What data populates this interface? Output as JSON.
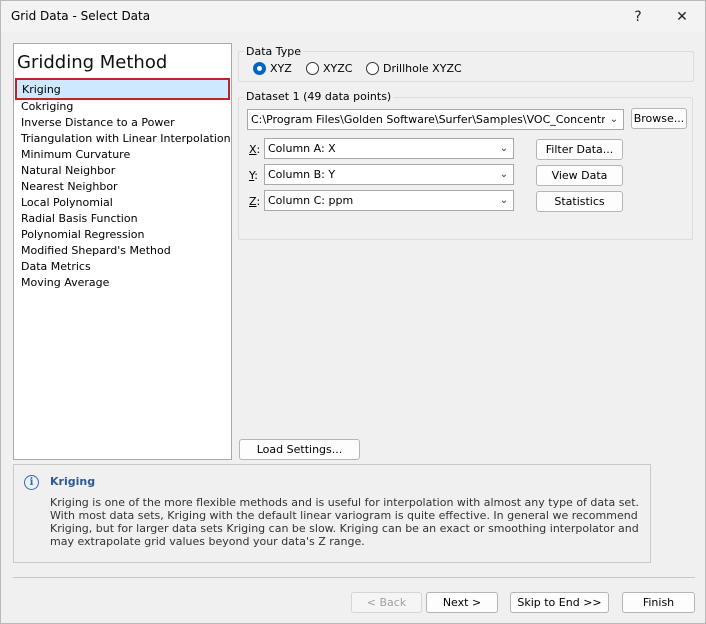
{
  "window": {
    "title": "Grid Data - Select Data",
    "help_label": "?",
    "close_label": "✕"
  },
  "methods": {
    "heading": "Gridding Method",
    "items": [
      "Kriging",
      "Cokriging",
      "Inverse Distance to a Power",
      "Triangulation with Linear Interpolation",
      "Minimum Curvature",
      "Natural Neighbor",
      "Nearest Neighbor",
      "Local Polynomial",
      "Radial Basis Function",
      "Polynomial Regression",
      "Modified Shepard's Method",
      "Data Metrics",
      "Moving Average"
    ],
    "selected": "Kriging"
  },
  "data_type": {
    "label": "Data Type",
    "options": [
      "XYZ",
      "XYZC",
      "Drillhole XYZC"
    ],
    "selected": "XYZ"
  },
  "dataset": {
    "label": "Dataset 1",
    "count": "(49 data points)",
    "path": "C:\\Program Files\\Golden Software\\Surfer\\Samples\\VOC_Concentration.xlsx",
    "browse_label": "Browse...",
    "x_label_key": "X",
    "x_label_rest": ":",
    "x_value": "Column A:  X",
    "y_label_key": "Y",
    "y_label_rest": ":",
    "y_value": "Column B:  Y",
    "z_label_key": "Z",
    "z_label_rest": ":",
    "z_value": "Column C:  ppm",
    "filter_label": "Filter Data...",
    "view_label": "View Data",
    "stats_label": "Statistics"
  },
  "load_settings_label": "Load Settings...",
  "info": {
    "icon": "info-icon",
    "title": "Kriging",
    "text": "Kriging is one of the more flexible methods and is useful for interpolation with almost any type of data set. With most data sets, Kriging with the default linear variogram is quite effective. In general we recommend Kriging, but for larger data sets Kriging can be slow. Kriging can be an exact or smoothing interpolator and may extrapolate grid values beyond your data's Z range."
  },
  "footer": {
    "back_label": "< Back",
    "next_label": "Next >",
    "skip_label": "Skip to End >>",
    "finish_label": "Finish"
  },
  "colors": {
    "selection_outline": "#c42027",
    "selection_fill": "#cde8ff",
    "radio_accent": "#0067c0",
    "info_title": "#2c5a94"
  }
}
